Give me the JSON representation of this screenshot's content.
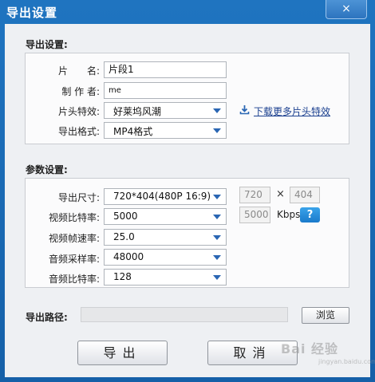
{
  "window": {
    "title": "导出设置",
    "close_icon": "×"
  },
  "export_section": {
    "title": "导出设置:",
    "name_label": "片　　名:",
    "name_value": "片段1",
    "author_label": "制 作 者:",
    "author_value": "me",
    "intro_label": "片头特效:",
    "intro_value": "好莱坞风潮",
    "download_link": "下载更多片头特效",
    "format_label": "导出格式:",
    "format_value": "MP4格式"
  },
  "params_section": {
    "title": "参数设置:",
    "size_label": "导出尺寸:",
    "size_value": "720*404(480P 16:9)",
    "width_value": "720",
    "times_symbol": "×",
    "height_value": "404",
    "video_bitrate_label": "视频比特率:",
    "video_bitrate_value": "5000",
    "bitrate_display": "5000",
    "bitrate_unit": "Kbps",
    "help_label": "?",
    "framerate_label": "视频帧速率:",
    "framerate_value": "25.0",
    "audio_samplerate_label": "音频采样率:",
    "audio_samplerate_value": "48000",
    "audio_bitrate_label": "音频比特率:",
    "audio_bitrate_value": "128"
  },
  "path": {
    "label": "导出路径:",
    "value": "",
    "browse_label": "浏览"
  },
  "actions": {
    "export_label": "导出",
    "cancel_label": "取消"
  },
  "watermark": {
    "text": "Bai 经验",
    "sub": "jingyan.baidu.com"
  },
  "colors": {
    "titlebar": "#1f74c0",
    "accent_arrow": "#2a66b3",
    "link": "#1a3f8f",
    "help_button": "#1a7acb"
  }
}
